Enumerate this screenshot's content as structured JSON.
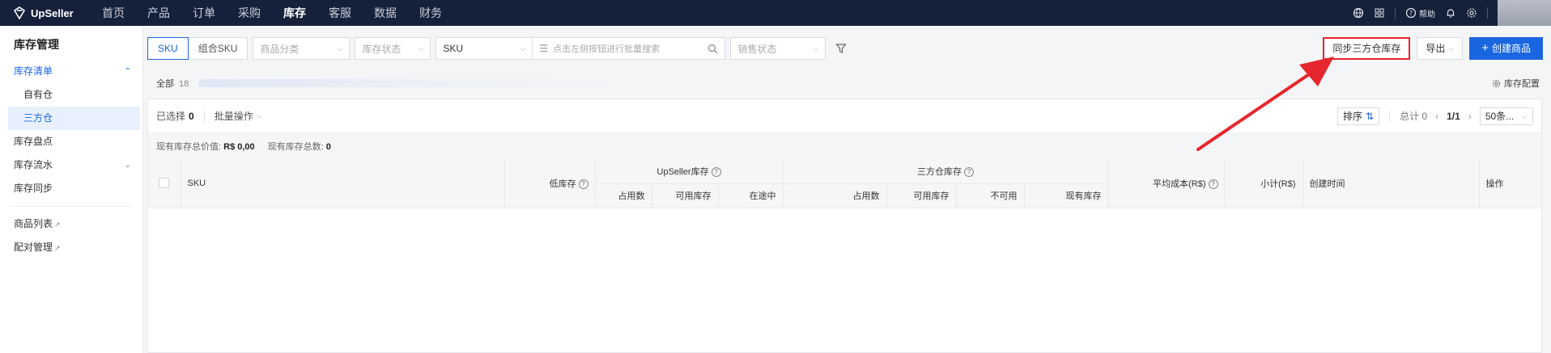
{
  "app": {
    "name": "UpSeller"
  },
  "nav": [
    {
      "label": "首页"
    },
    {
      "label": "产品"
    },
    {
      "label": "订单"
    },
    {
      "label": "采购"
    },
    {
      "label": "库存"
    },
    {
      "label": "客服"
    },
    {
      "label": "数据"
    },
    {
      "label": "财务"
    }
  ],
  "top_right": {
    "help_label": "帮助"
  },
  "sidebar": {
    "title": "库存管理",
    "items": [
      {
        "label": "库存清单"
      },
      {
        "label": "自有仓"
      },
      {
        "label": "三方仓"
      },
      {
        "label": "库存盘点"
      },
      {
        "label": "库存流水"
      },
      {
        "label": "库存同步"
      },
      {
        "label": "商品列表"
      },
      {
        "label": "配对管理"
      }
    ]
  },
  "toolbar": {
    "seg_sku": "SKU",
    "seg_combo": "组合SKU",
    "category_placeholder": "商品分类",
    "stock_status_placeholder": "库存状态",
    "search_type": "SKU",
    "search_placeholder": "点击左侧按钮进行批量搜索",
    "sale_status_placeholder": "销售状态",
    "sync_label": "同步三方仓库存",
    "export_label": "导出",
    "create_label": "创建商品"
  },
  "status": {
    "all_label": "全部",
    "all_count": "18",
    "config_label": "库存配置"
  },
  "selbar": {
    "selected_label": "已选择",
    "selected_count": "0",
    "batch_label": "批量操作",
    "sort_label": "排序",
    "total_label": "总计",
    "total_count": "0",
    "page": "1/1",
    "page_size": "50条..."
  },
  "summary": {
    "value_label": "现有库存总价值:",
    "value": "R$ 0,00",
    "qty_label": "现有库存总数:",
    "qty": "0"
  },
  "table": {
    "sku": "SKU",
    "low_stock": "低库存",
    "upseller_group": "UpSeller库存",
    "third_group": "三方仓库存",
    "occupied": "占用数",
    "available": "可用库存",
    "in_transit": "在途中",
    "third_occupied": "占用数",
    "third_available": "可用库存",
    "unavailable": "不可用",
    "on_hand": "现有库存",
    "avg_cost": "平均成本(R$)",
    "subtotal": "小计(R$)",
    "created": "创建时间",
    "action": "操作"
  },
  "colors": {
    "accent": "#1a66e0",
    "highlight": "#e6262e",
    "topbar": "#15213a"
  }
}
